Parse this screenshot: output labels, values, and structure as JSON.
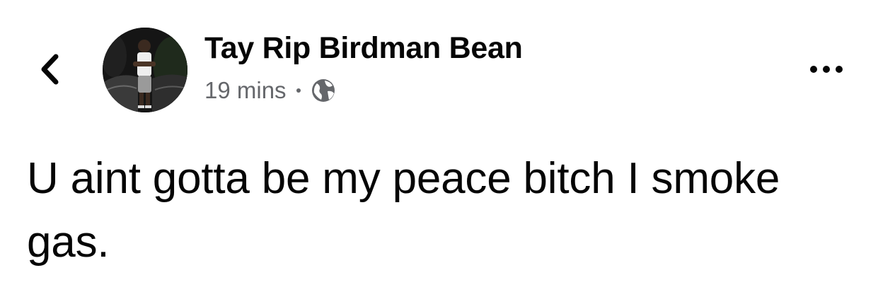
{
  "header": {
    "back_icon": "chevron-left-icon",
    "avatar_icon": "profile-photo",
    "author_name": "Tay Rip Birdman Bean",
    "timestamp": "19 mins",
    "privacy_icon": "globe-icon",
    "more_icon": "more-horizontal-icon"
  },
  "post": {
    "text": "U aint gotta be my peace bitch I smoke gas."
  },
  "colors": {
    "text_primary": "#050505",
    "text_secondary": "#65676b",
    "background": "#ffffff"
  }
}
